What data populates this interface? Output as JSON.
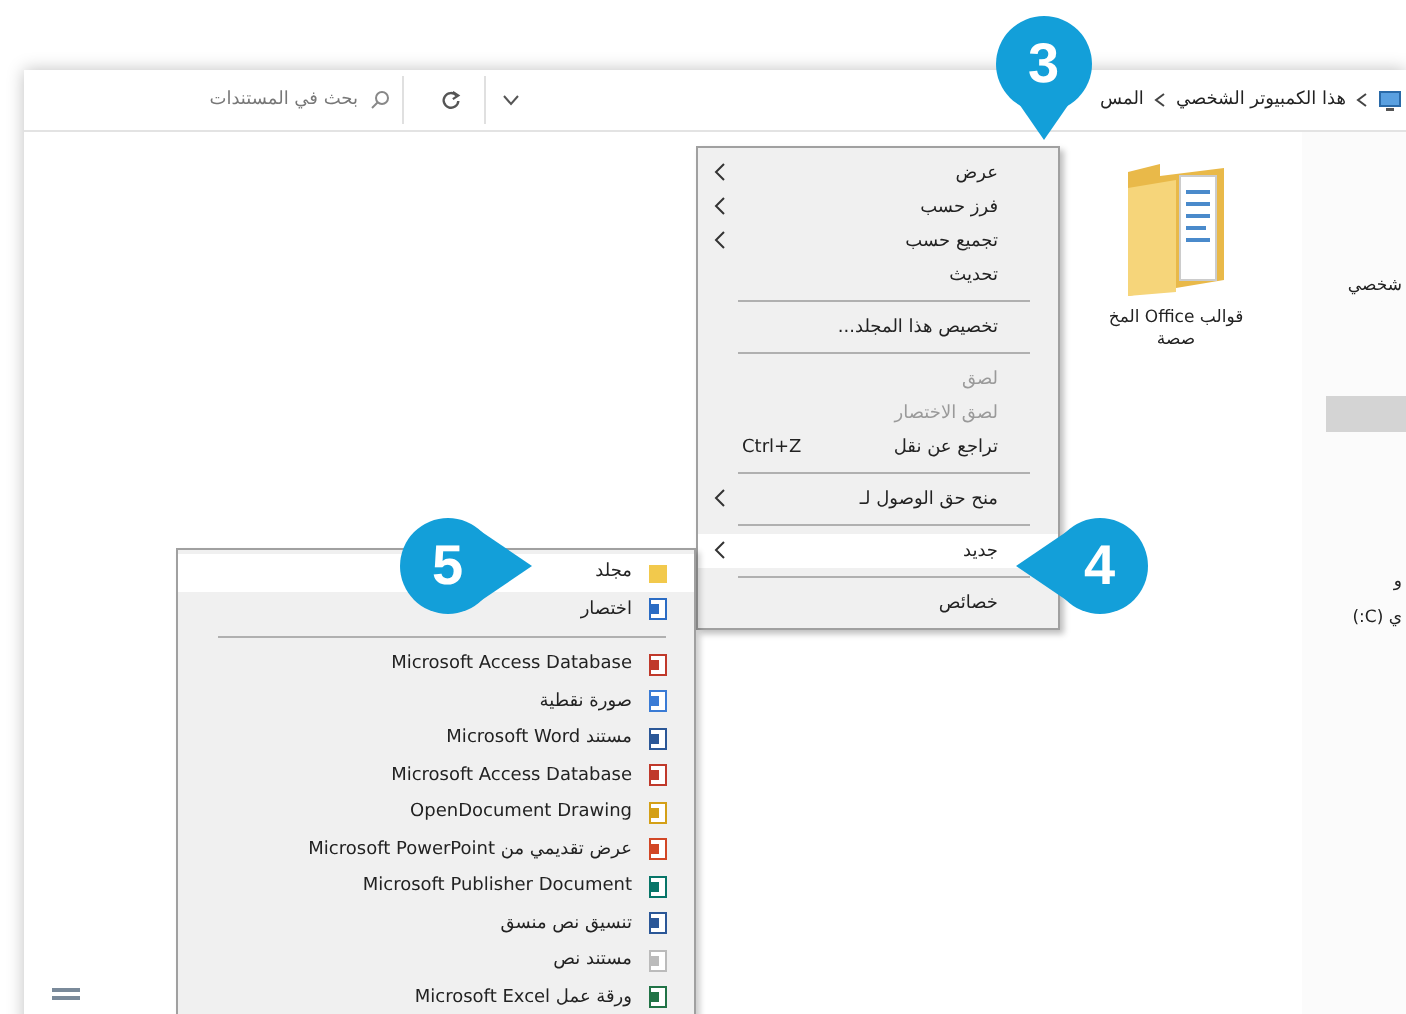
{
  "address_bar": {
    "breadcrumbs": [
      {
        "label": "هذا الكمبيوتر الشخصي"
      },
      {
        "label": "المس"
      }
    ],
    "search": {
      "placeholder": "بحث في المستندات"
    }
  },
  "folder": {
    "label_lines": [
      "قوالب Office المخ",
      "صصة"
    ]
  },
  "right_pane": {
    "texts": [
      "شخصي",
      "و",
      "ي (C:)"
    ]
  },
  "context_menu": [
    {
      "kind": "item",
      "label": "عرض",
      "submenu": true,
      "disabled": false,
      "selected": false
    },
    {
      "kind": "item",
      "label": "فرز حسب",
      "submenu": true,
      "disabled": false,
      "selected": false
    },
    {
      "kind": "item",
      "label": "تجميع حسب",
      "submenu": true,
      "disabled": false,
      "selected": false
    },
    {
      "kind": "item",
      "label": "تحديث",
      "submenu": false,
      "disabled": false,
      "selected": false
    },
    {
      "kind": "separator"
    },
    {
      "kind": "item",
      "label": "تخصيص هذا المجلد...",
      "submenu": false,
      "disabled": false,
      "selected": false
    },
    {
      "kind": "separator"
    },
    {
      "kind": "item",
      "label": "لصق",
      "submenu": false,
      "disabled": true,
      "selected": false
    },
    {
      "kind": "item",
      "label": "لصق الاختصار",
      "submenu": false,
      "disabled": true,
      "selected": false
    },
    {
      "kind": "item",
      "label": "تراجع عن نقل",
      "shortcut": "Ctrl+Z",
      "submenu": false,
      "disabled": false,
      "selected": false
    },
    {
      "kind": "separator"
    },
    {
      "kind": "item",
      "label": "منح حق الوصول لـ",
      "submenu": true,
      "disabled": false,
      "selected": false
    },
    {
      "kind": "separator"
    },
    {
      "kind": "item",
      "label": "جديد",
      "submenu": true,
      "disabled": false,
      "selected": true
    },
    {
      "kind": "separator"
    },
    {
      "kind": "item",
      "label": "خصائص",
      "submenu": false,
      "disabled": false,
      "selected": false
    }
  ],
  "new_submenu": [
    {
      "kind": "folder",
      "label": "مجلد",
      "selected": true
    },
    {
      "kind": "shortcut",
      "label": "اختصار",
      "selected": false
    },
    {
      "kind": "separator"
    },
    {
      "kind": "access",
      "label": "Microsoft Access Database",
      "selected": false
    },
    {
      "kind": "image",
      "label": "صورة نقطية",
      "selected": false
    },
    {
      "kind": "word",
      "label": "مستند Microsoft Word",
      "selected": false
    },
    {
      "kind": "access",
      "label": "Microsoft Access Database",
      "selected": false
    },
    {
      "kind": "drawing",
      "label": "OpenDocument Drawing",
      "selected": false
    },
    {
      "kind": "powerpoint",
      "label": "عرض تقديمي من Microsoft PowerPoint",
      "selected": false
    },
    {
      "kind": "publisher",
      "label": "Microsoft Publisher Document",
      "selected": false
    },
    {
      "kind": "word",
      "label": "تنسيق نص منسق",
      "selected": false
    },
    {
      "kind": "text",
      "label": "مستند نص",
      "selected": false
    },
    {
      "kind": "excel",
      "label": "ورقة عمل Microsoft Excel",
      "selected": false
    }
  ],
  "callouts": [
    {
      "number": "3",
      "kind": "down"
    },
    {
      "number": "4",
      "kind": "left"
    },
    {
      "number": "5",
      "kind": "right"
    }
  ]
}
